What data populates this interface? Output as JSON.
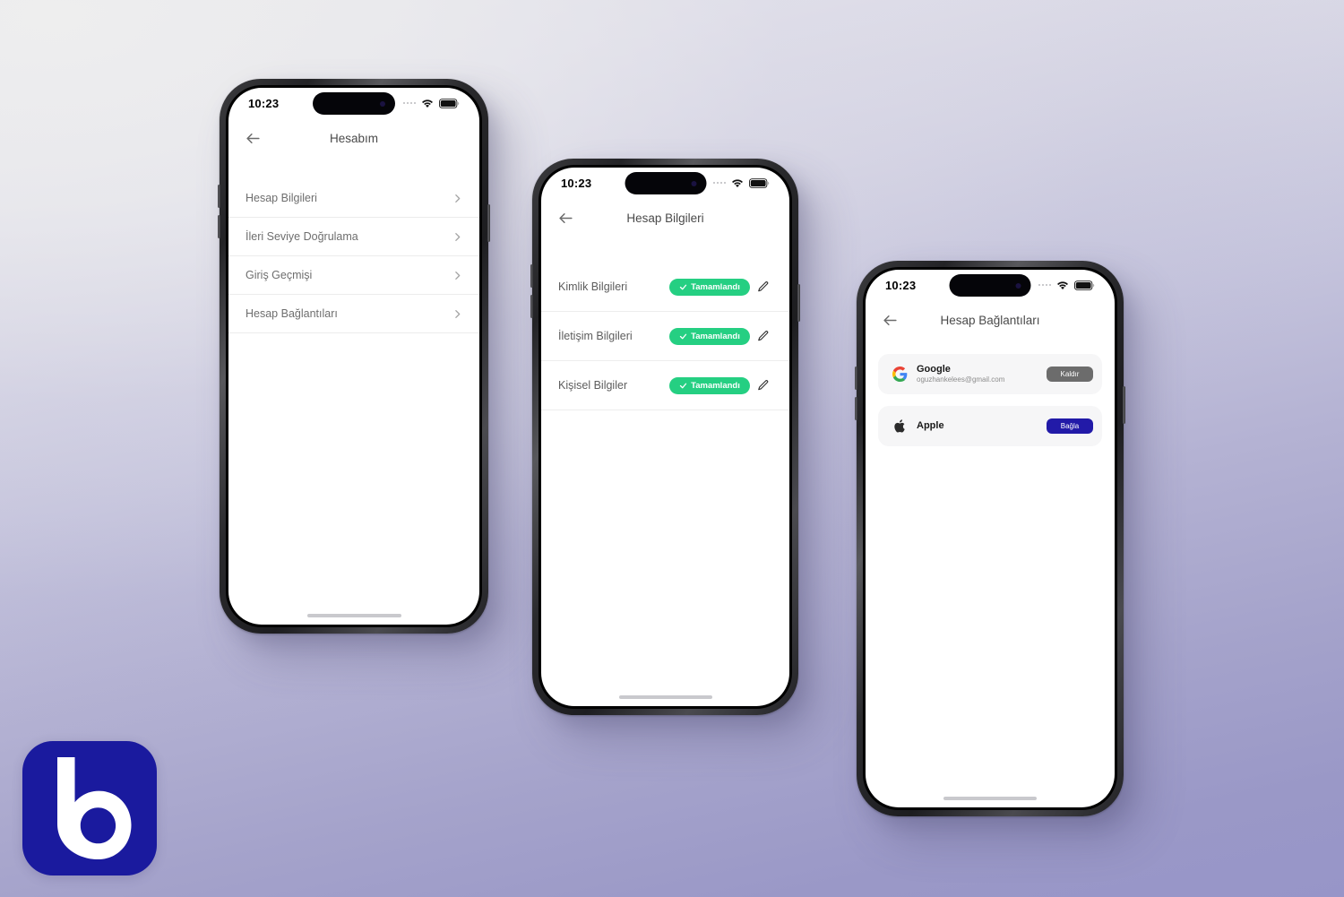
{
  "canvas": {
    "background_from": "#e9e9ea",
    "background_to": "#9795c8"
  },
  "brand_logo": {
    "icon": "letter-b-logo-icon",
    "letter": "b",
    "background_color": "#1a1a9e",
    "mark_color": "#ffffff"
  },
  "status_bar": {
    "time": "10:23",
    "signal_icon": "signal-dots-icon",
    "wifi_icon": "wifi-icon",
    "battery_icon": "battery-full-icon"
  },
  "phones": [
    {
      "id": "phone-hesabim",
      "nav": {
        "back_icon": "back-arrow-icon",
        "title": "Hesabım"
      },
      "screen_type": "plain-list",
      "list": [
        {
          "label": "Hesap Bilgileri",
          "chevron_icon": "chevron-right-icon"
        },
        {
          "label": "İleri Seviye Doğrulama",
          "chevron_icon": "chevron-right-icon"
        },
        {
          "label": "Giriş Geçmişi",
          "chevron_icon": "chevron-right-icon"
        },
        {
          "label": "Hesap Bağlantıları",
          "chevron_icon": "chevron-right-icon"
        }
      ]
    },
    {
      "id": "phone-hesap-bilgileri",
      "nav": {
        "back_icon": "back-arrow-icon",
        "title": "Hesap Bilgileri"
      },
      "screen_type": "status-list",
      "status_color": "#25cf82",
      "rows": [
        {
          "label": "Kimlik Bilgileri",
          "status": "Tamamlandı",
          "check_icon": "check-icon",
          "edit_icon": "pencil-edit-icon"
        },
        {
          "label": "İletişim Bilgileri",
          "status": "Tamamlandı",
          "check_icon": "check-icon",
          "edit_icon": "pencil-edit-icon"
        },
        {
          "label": "Kişisel Bilgiler",
          "status": "Tamamlandı",
          "check_icon": "check-icon",
          "edit_icon": "pencil-edit-icon"
        }
      ]
    },
    {
      "id": "phone-hesap-baglantilari",
      "nav": {
        "back_icon": "back-arrow-icon",
        "title": "Hesap Bağlantıları"
      },
      "screen_type": "card-list",
      "cards": [
        {
          "provider_icon": "google-logo-icon",
          "name": "Google",
          "detail": "oguzhankelees@gmail.com",
          "action_label": "Kaldır",
          "action_color": "#6c6c6c"
        },
        {
          "provider_icon": "apple-logo-icon",
          "name": "Apple",
          "detail": "",
          "action_label": "Bağla",
          "action_color": "#221aa8"
        }
      ]
    }
  ]
}
